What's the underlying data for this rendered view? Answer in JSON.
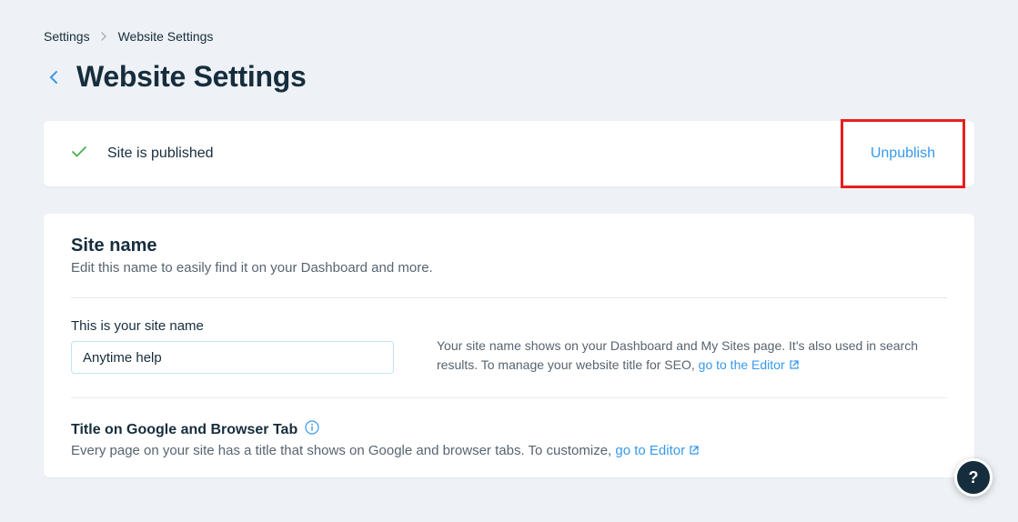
{
  "breadcrumb": {
    "parent": "Settings",
    "current": "Website Settings"
  },
  "page": {
    "title": "Website Settings"
  },
  "publish": {
    "status_text": "Site is published",
    "action_label": "Unpublish"
  },
  "site_name": {
    "heading": "Site name",
    "subheading": "Edit this name to easily find it on your Dashboard and more.",
    "input_label": "This is your site name",
    "input_value": "Anytime help",
    "help_text_prefix": "Your site name shows on your Dashboard and My Sites page. It's also used in search results. To manage your website title for SEO, ",
    "help_link_label": "go to the Editor"
  },
  "title_on_google": {
    "heading": "Title on Google and Browser Tab",
    "desc_prefix": "Every page on your site has a title that shows on Google and browser tabs. To customize, ",
    "link_label": "go to Editor"
  },
  "help_fab": {
    "glyph": "?"
  }
}
